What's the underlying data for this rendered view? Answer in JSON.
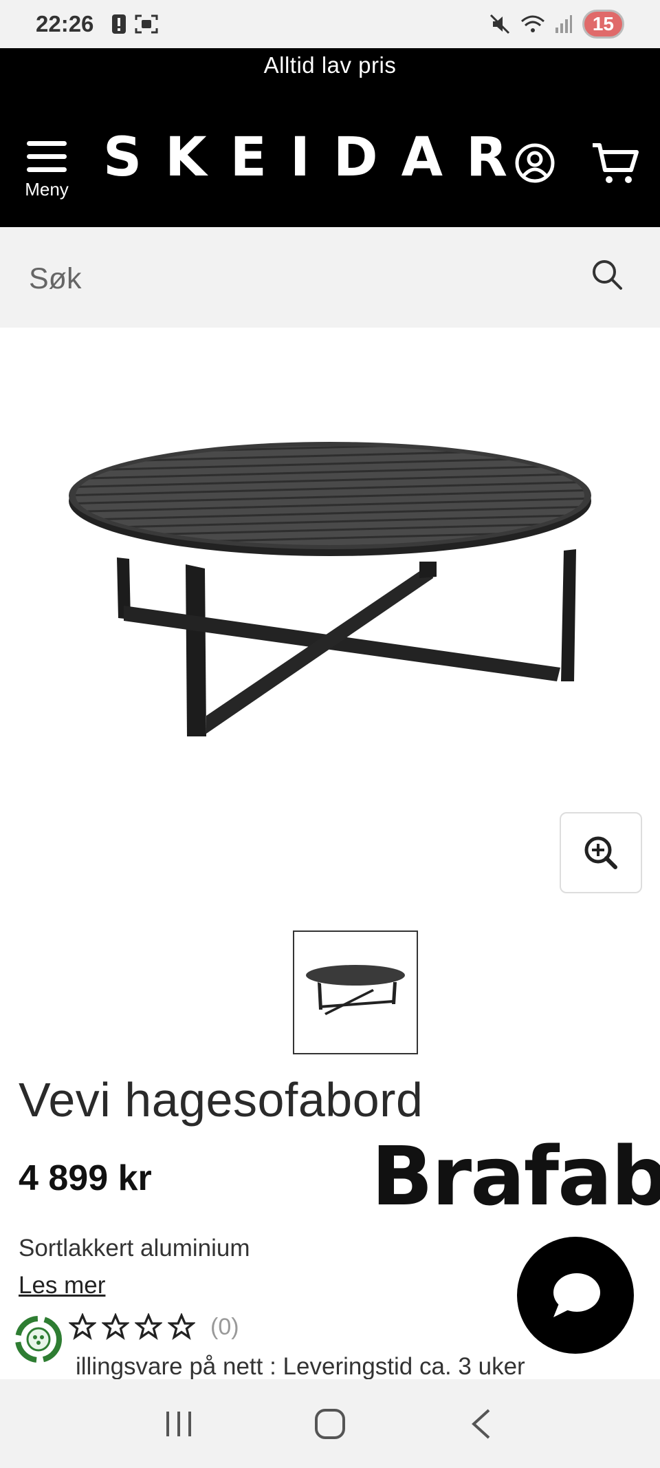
{
  "status_bar": {
    "time": "22:26",
    "battery_level": "15"
  },
  "header": {
    "tagline": "Alltid lav pris",
    "menu_label": "Meny",
    "logo_text": "SKEIDAR"
  },
  "search": {
    "placeholder": "Søk"
  },
  "product": {
    "title": "Vevi hagesofabord",
    "price": "4 899 kr",
    "brand": "Brafab",
    "description": "Sortlakkert aluminium",
    "read_more_label": "Les mer",
    "rating_count": "(0)",
    "rating_stars": 0,
    "delivery_text": "illingsvare på nett : Leveringstid ca. 3 uker",
    "thumbnail_count": 1
  },
  "icons": {
    "menu": "hamburger-icon",
    "account": "user-circle-icon",
    "cart": "cart-icon",
    "search": "search-icon",
    "zoom": "zoom-in-icon",
    "chat": "chat-bubble-icon",
    "eco": "recycle-icon"
  },
  "colors": {
    "header_bg": "#000000",
    "search_bg": "#f2f2f2",
    "eco_green": "#2e7d32"
  }
}
